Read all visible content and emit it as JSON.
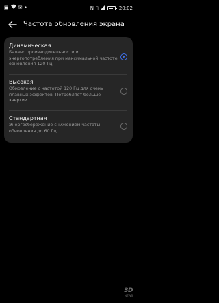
{
  "status_bar": {
    "left_icons": [
      "image-icon",
      "wifi-icon",
      "message-icon",
      "dot-icon"
    ],
    "time": "20:02",
    "battery_level": 0.7
  },
  "header": {
    "title": "Частота обновления экрана"
  },
  "options": [
    {
      "title": "Динамическая",
      "description": "Баланс производительности и энергопотребления при максимальной частоте обновления 120 Гц.",
      "selected": true
    },
    {
      "title": "Высокая",
      "description": "Обновление с частотой 120 Гц для очень плавных эффектов. Потребляет больше энергии.",
      "selected": false
    },
    {
      "title": "Стандартная",
      "description": "Энергосбережение снижением частоты обновления до 60 Гц.",
      "selected": false
    }
  ],
  "watermark": {
    "main": "3D",
    "sub": "NEWS"
  },
  "colors": {
    "accent": "#3f6fe6",
    "card_bg": "#262626",
    "background": "#000000"
  }
}
